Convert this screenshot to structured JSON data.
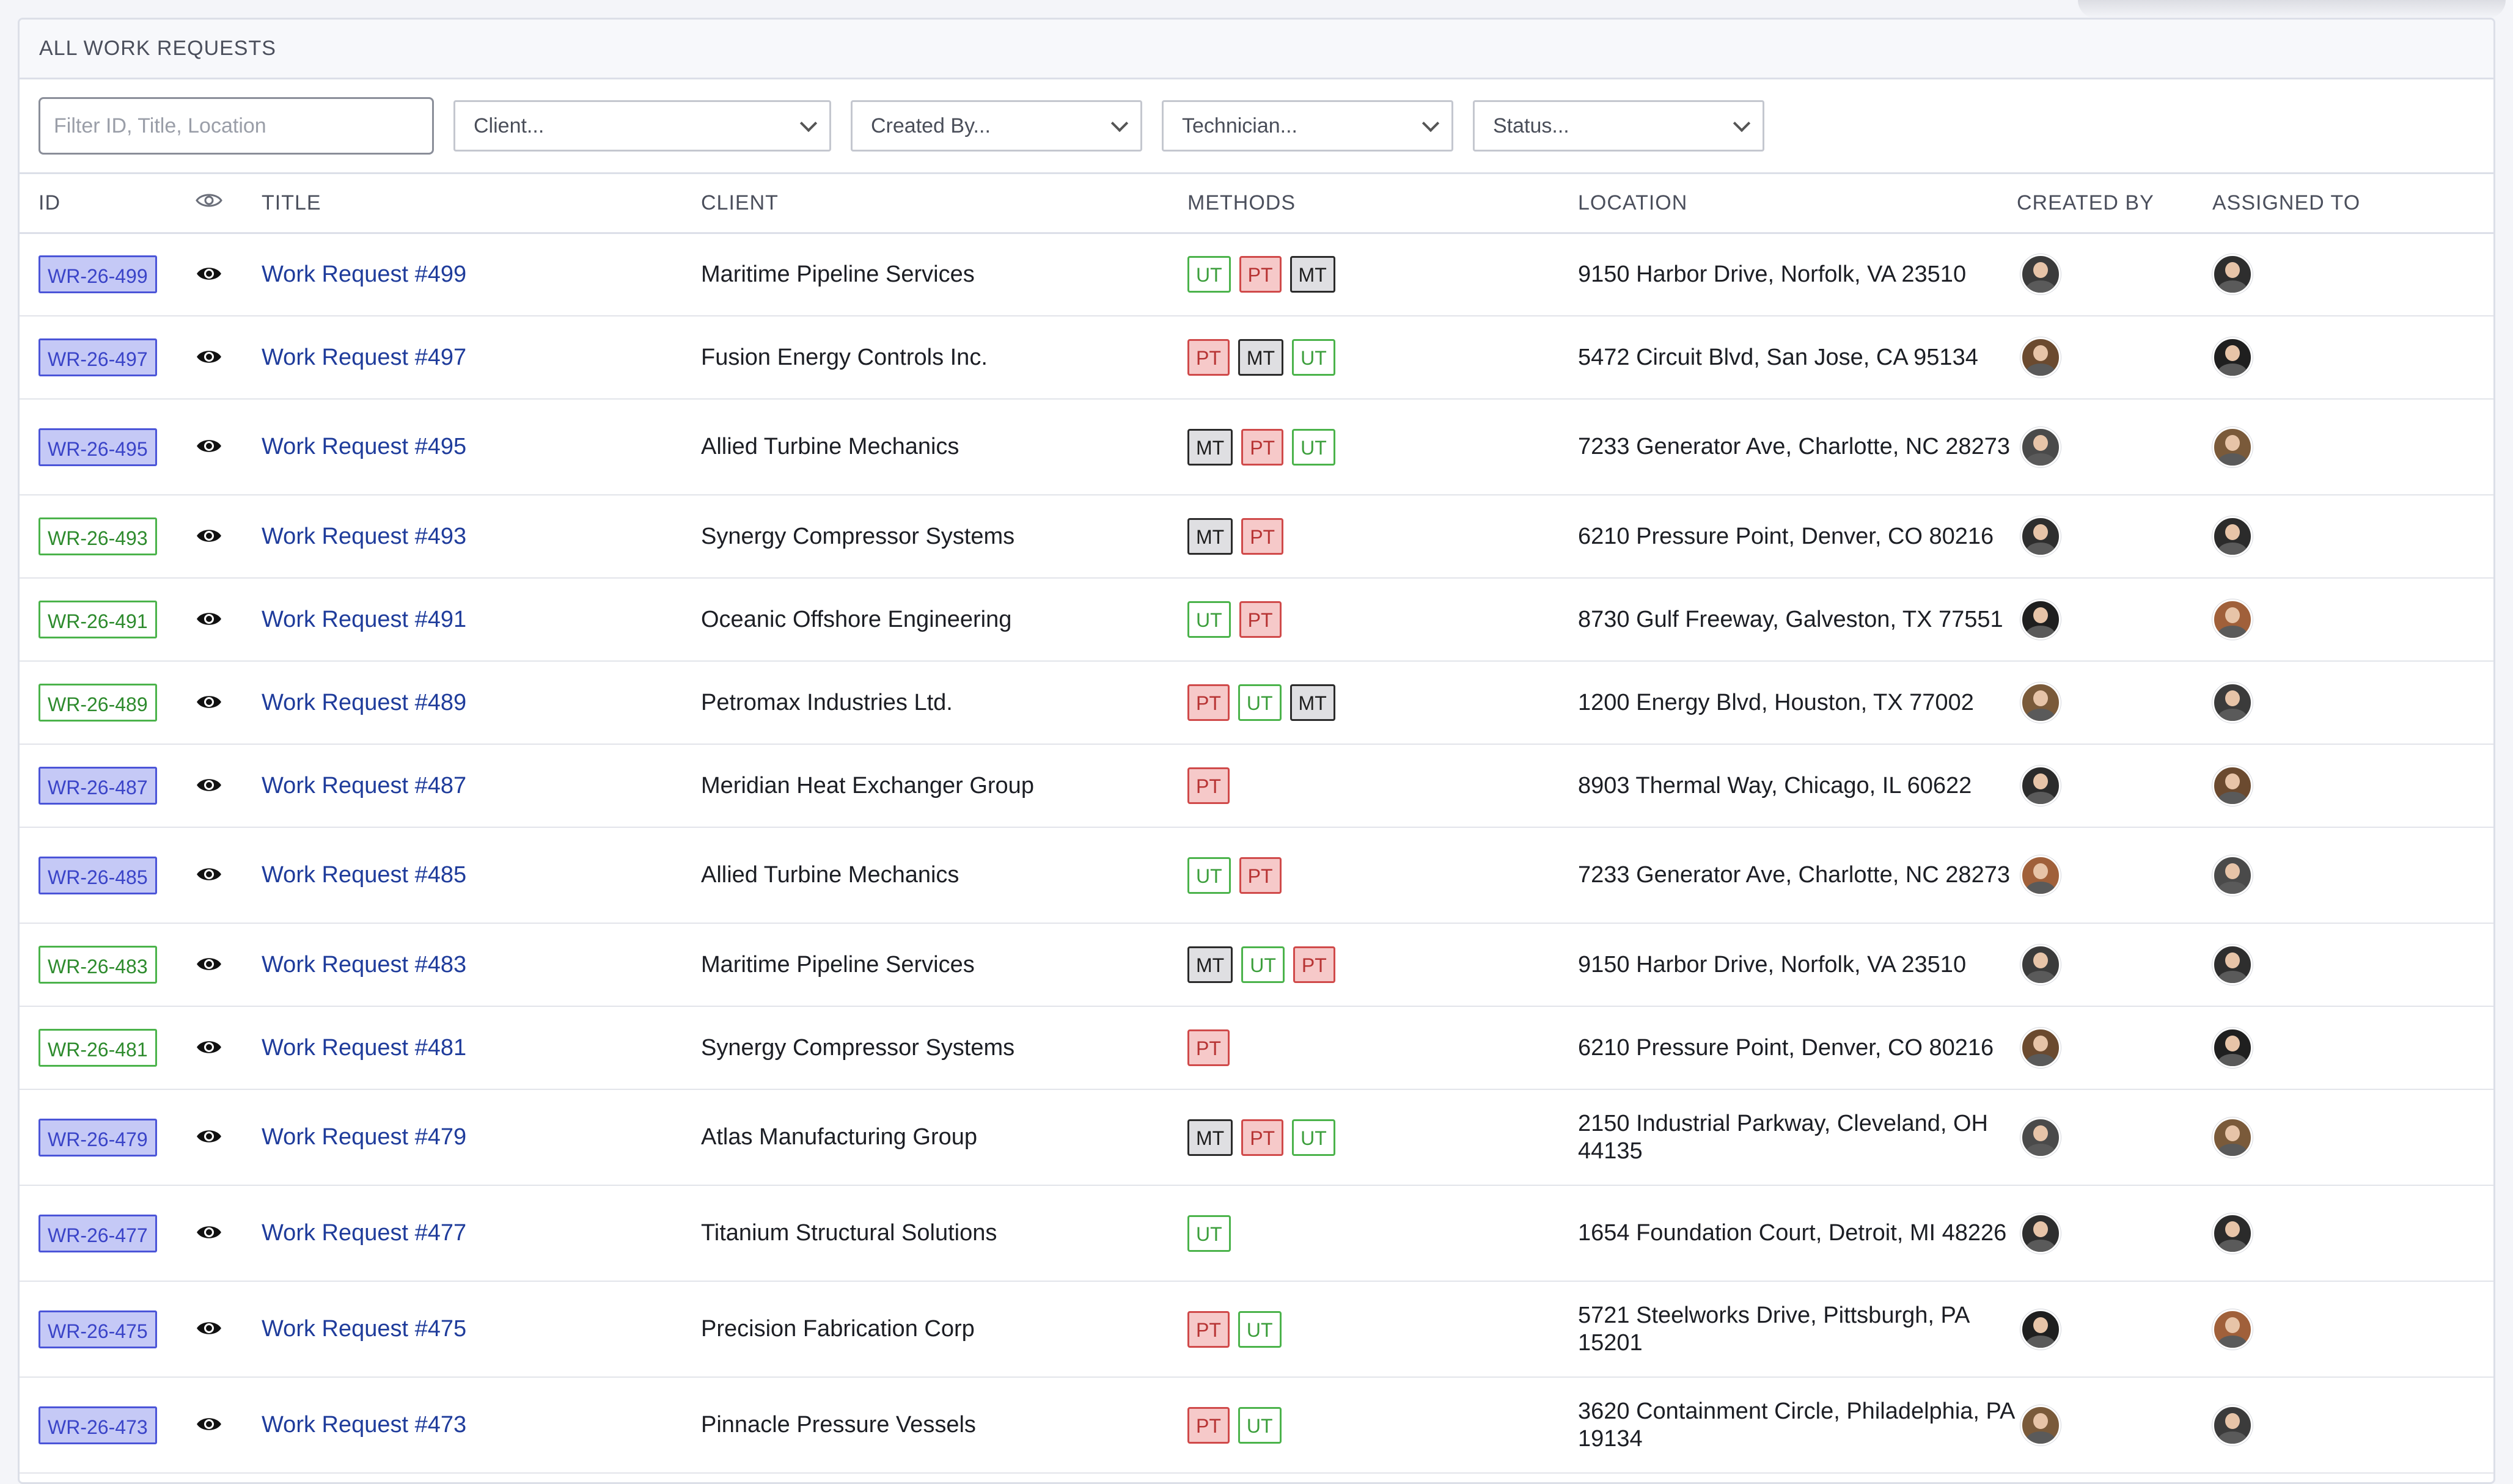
{
  "panel": {
    "title": "ALL WORK REQUESTS"
  },
  "filters": {
    "search_placeholder": "Filter ID, Title, Location",
    "client": "Client...",
    "created_by": "Created By...",
    "technician": "Technician...",
    "status": "Status..."
  },
  "columns": {
    "id": "ID",
    "title": "TITLE",
    "client": "CLIENT",
    "methods": "METHODS",
    "location": "LOCATION",
    "created_by": "CREATED BY",
    "assigned_to": "ASSIGNED TO"
  },
  "colors": {
    "blue_badge": "#c5c9f6",
    "green_badge": "#4bb34b",
    "link": "#1f3c9b"
  },
  "rows": [
    {
      "id": "WR-26-499",
      "badge": "blue",
      "title": "Work Request #499",
      "client": "Maritime Pipeline Services",
      "methods": [
        "UT",
        "PT",
        "MT"
      ],
      "location": "9150 Harbor Drive, Norfolk, VA 23510"
    },
    {
      "id": "WR-26-497",
      "badge": "blue",
      "title": "Work Request #497",
      "client": "Fusion Energy Controls Inc.",
      "methods": [
        "PT",
        "MT",
        "UT"
      ],
      "location": "5472 Circuit Blvd, San Jose, CA 95134"
    },
    {
      "id": "WR-26-495",
      "badge": "blue",
      "title": "Work Request #495",
      "client": "Allied Turbine Mechanics",
      "methods": [
        "MT",
        "PT",
        "UT"
      ],
      "location": "7233 Generator Ave, Charlotte, NC 28273"
    },
    {
      "id": "WR-26-493",
      "badge": "green",
      "title": "Work Request #493",
      "client": "Synergy Compressor Systems",
      "methods": [
        "MT",
        "PT"
      ],
      "location": "6210 Pressure Point, Denver, CO 80216"
    },
    {
      "id": "WR-26-491",
      "badge": "green",
      "title": "Work Request #491",
      "client": "Oceanic Offshore Engineering",
      "methods": [
        "UT",
        "PT"
      ],
      "location": "8730 Gulf Freeway, Galveston, TX 77551"
    },
    {
      "id": "WR-26-489",
      "badge": "green",
      "title": "Work Request #489",
      "client": "Petromax Industries Ltd.",
      "methods": [
        "PT",
        "UT",
        "MT"
      ],
      "location": "1200 Energy Blvd, Houston, TX 77002"
    },
    {
      "id": "WR-26-487",
      "badge": "blue",
      "title": "Work Request #487",
      "client": "Meridian Heat Exchanger Group",
      "methods": [
        "PT"
      ],
      "location": "8903 Thermal Way, Chicago, IL 60622"
    },
    {
      "id": "WR-26-485",
      "badge": "blue",
      "title": "Work Request #485",
      "client": "Allied Turbine Mechanics",
      "methods": [
        "UT",
        "PT"
      ],
      "location": "7233 Generator Ave, Charlotte, NC 28273"
    },
    {
      "id": "WR-26-483",
      "badge": "green",
      "title": "Work Request #483",
      "client": "Maritime Pipeline Services",
      "methods": [
        "MT",
        "UT",
        "PT"
      ],
      "location": "9150 Harbor Drive, Norfolk, VA 23510"
    },
    {
      "id": "WR-26-481",
      "badge": "green",
      "title": "Work Request #481",
      "client": "Synergy Compressor Systems",
      "methods": [
        "PT"
      ],
      "location": "6210 Pressure Point, Denver, CO 80216"
    },
    {
      "id": "WR-26-479",
      "badge": "blue",
      "title": "Work Request #479",
      "client": "Atlas Manufacturing Group",
      "methods": [
        "MT",
        "PT",
        "UT"
      ],
      "location": "2150 Industrial Parkway, Cleveland, OH 44135"
    },
    {
      "id": "WR-26-477",
      "badge": "blue",
      "title": "Work Request #477",
      "client": "Titanium Structural Solutions",
      "methods": [
        "UT"
      ],
      "location": "1654 Foundation Court, Detroit, MI 48226"
    },
    {
      "id": "WR-26-475",
      "badge": "blue",
      "title": "Work Request #475",
      "client": "Precision Fabrication Corp",
      "methods": [
        "PT",
        "UT"
      ],
      "location": "5721 Steelworks Drive, Pittsburgh, PA 15201"
    },
    {
      "id": "WR-26-473",
      "badge": "blue",
      "title": "Work Request #473",
      "client": "Pinnacle Pressure Vessels",
      "methods": [
        "PT",
        "UT"
      ],
      "location": "3620 Containment Circle, Philadelphia, PA 19134"
    }
  ]
}
